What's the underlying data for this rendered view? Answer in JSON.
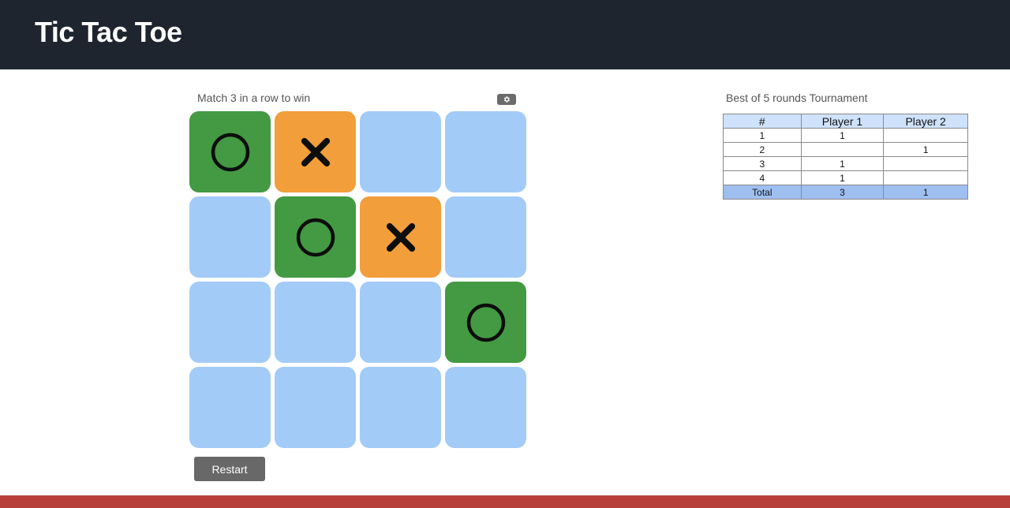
{
  "header": {
    "title": "Tic Tac Toe"
  },
  "game": {
    "instructions": "Match 3 in a row to win",
    "settings_icon": "gear-icon",
    "board": [
      [
        "O",
        "X",
        "",
        ""
      ],
      [
        "",
        "O",
        "X",
        ""
      ],
      [
        "",
        "",
        "",
        "O"
      ],
      [
        "",
        "",
        "",
        ""
      ]
    ],
    "colors": {
      "empty": "#a3cbf7",
      "o": "#439a42",
      "x": "#f29e3b"
    },
    "restart_label": "Restart"
  },
  "tournament": {
    "title": "Best of 5 rounds Tournament",
    "headers": [
      "#",
      "Player 1",
      "Player 2"
    ],
    "rows": [
      [
        "1",
        "1",
        ""
      ],
      [
        "2",
        "",
        "1"
      ],
      [
        "3",
        "1",
        ""
      ],
      [
        "4",
        "1",
        ""
      ]
    ],
    "total": [
      "Total",
      "3",
      "1"
    ]
  }
}
